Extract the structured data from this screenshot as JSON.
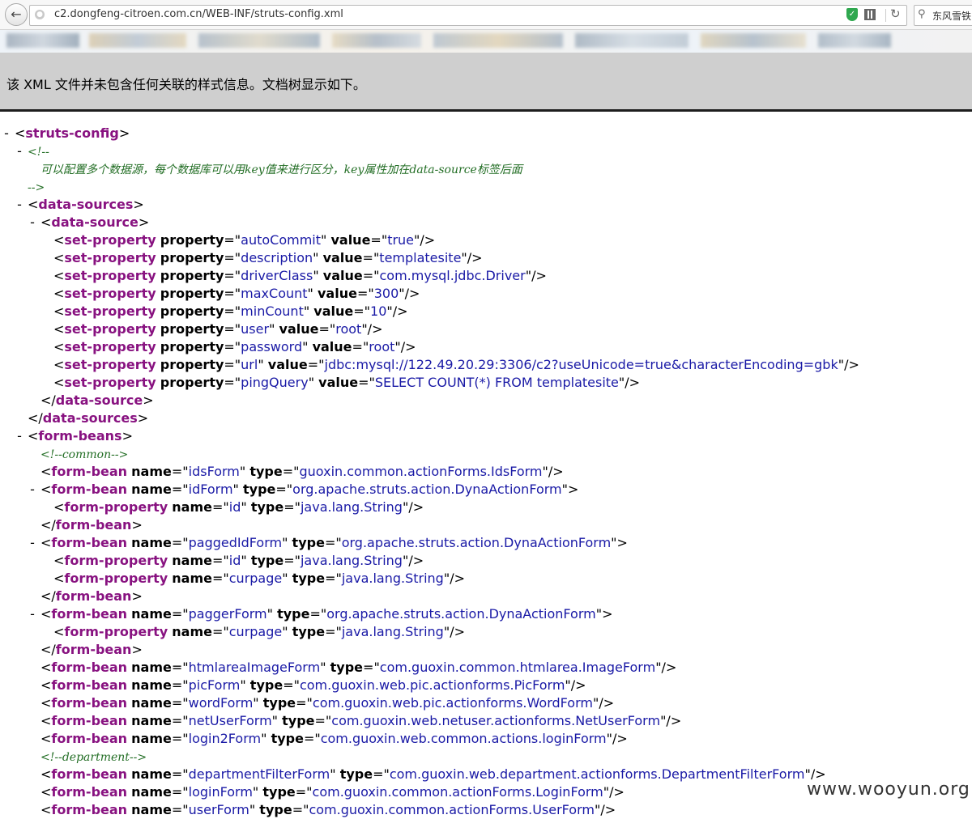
{
  "browser": {
    "url": "c2.dongfeng-citroen.com.cn/WEB-INF/struts-config.xml",
    "search_text": "东风雪铁",
    "icons": [
      "back-icon",
      "globe-icon",
      "shield-icon",
      "qr-icon",
      "refresh-icon",
      "search-icon"
    ]
  },
  "info_message": "该 XML 文件并未包含任何关联的样式信息。文档树显示如下。",
  "xml_lines": [
    {
      "indent": 0,
      "toggle": "-",
      "kind": "open",
      "tag": "struts-config"
    },
    {
      "indent": 1,
      "toggle": "-",
      "kind": "comment",
      "text": "<!--"
    },
    {
      "indent": 2,
      "toggle": "",
      "kind": "comment",
      "text": "可以配置多个数据源，每个数据库可以用key值来进行区分，key属性加在data-source标签后面"
    },
    {
      "indent": 1,
      "toggle": "",
      "kind": "comment",
      "text": "-->"
    },
    {
      "indent": 1,
      "toggle": "-",
      "kind": "open",
      "tag": "data-sources"
    },
    {
      "indent": 2,
      "toggle": "-",
      "kind": "open",
      "tag": "data-source"
    },
    {
      "indent": 3,
      "toggle": "",
      "kind": "self",
      "tag": "set-property",
      "attrs": [
        [
          "property",
          "autoCommit"
        ],
        [
          "value",
          "true"
        ]
      ]
    },
    {
      "indent": 3,
      "toggle": "",
      "kind": "self",
      "tag": "set-property",
      "attrs": [
        [
          "property",
          "description"
        ],
        [
          "value",
          "templatesite"
        ]
      ]
    },
    {
      "indent": 3,
      "toggle": "",
      "kind": "self",
      "tag": "set-property",
      "attrs": [
        [
          "property",
          "driverClass"
        ],
        [
          "value",
          "com.mysql.jdbc.Driver"
        ]
      ]
    },
    {
      "indent": 3,
      "toggle": "",
      "kind": "self",
      "tag": "set-property",
      "attrs": [
        [
          "property",
          "maxCount"
        ],
        [
          "value",
          "300"
        ]
      ]
    },
    {
      "indent": 3,
      "toggle": "",
      "kind": "self",
      "tag": "set-property",
      "attrs": [
        [
          "property",
          "minCount"
        ],
        [
          "value",
          "10"
        ]
      ]
    },
    {
      "indent": 3,
      "toggle": "",
      "kind": "self",
      "tag": "set-property",
      "attrs": [
        [
          "property",
          "user"
        ],
        [
          "value",
          "root"
        ]
      ]
    },
    {
      "indent": 3,
      "toggle": "",
      "kind": "self",
      "tag": "set-property",
      "attrs": [
        [
          "property",
          "password"
        ],
        [
          "value",
          "root"
        ]
      ]
    },
    {
      "indent": 3,
      "toggle": "",
      "kind": "self",
      "tag": "set-property",
      "attrs": [
        [
          "property",
          "url"
        ],
        [
          "value",
          "jdbc:mysql://122.49.20.29:3306/c2?useUnicode=true&characterEncoding=gbk"
        ]
      ]
    },
    {
      "indent": 3,
      "toggle": "",
      "kind": "self",
      "tag": "set-property",
      "attrs": [
        [
          "property",
          "pingQuery"
        ],
        [
          "value",
          "SELECT COUNT(*) FROM templatesite"
        ]
      ]
    },
    {
      "indent": 2,
      "toggle": "",
      "kind": "close",
      "tag": "data-source"
    },
    {
      "indent": 1,
      "toggle": "",
      "kind": "close",
      "tag": "data-sources"
    },
    {
      "indent": 1,
      "toggle": "-",
      "kind": "open",
      "tag": "form-beans"
    },
    {
      "indent": 2,
      "toggle": "",
      "kind": "comment",
      "text": "<!--common-->"
    },
    {
      "indent": 2,
      "toggle": "",
      "kind": "self",
      "tag": "form-bean",
      "attrs": [
        [
          "name",
          "idsForm"
        ],
        [
          "type",
          "guoxin.common.actionForms.IdsForm"
        ]
      ]
    },
    {
      "indent": 2,
      "toggle": "-",
      "kind": "open",
      "tag": "form-bean",
      "attrs": [
        [
          "name",
          "idForm"
        ],
        [
          "type",
          "org.apache.struts.action.DynaActionForm"
        ]
      ]
    },
    {
      "indent": 3,
      "toggle": "",
      "kind": "self",
      "tag": "form-property",
      "attrs": [
        [
          "name",
          "id"
        ],
        [
          "type",
          "java.lang.String"
        ]
      ]
    },
    {
      "indent": 2,
      "toggle": "",
      "kind": "close",
      "tag": "form-bean"
    },
    {
      "indent": 2,
      "toggle": "-",
      "kind": "open",
      "tag": "form-bean",
      "attrs": [
        [
          "name",
          "paggedIdForm"
        ],
        [
          "type",
          "org.apache.struts.action.DynaActionForm"
        ]
      ]
    },
    {
      "indent": 3,
      "toggle": "",
      "kind": "self",
      "tag": "form-property",
      "attrs": [
        [
          "name",
          "id"
        ],
        [
          "type",
          "java.lang.String"
        ]
      ]
    },
    {
      "indent": 3,
      "toggle": "",
      "kind": "self",
      "tag": "form-property",
      "attrs": [
        [
          "name",
          "curpage"
        ],
        [
          "type",
          "java.lang.String"
        ]
      ]
    },
    {
      "indent": 2,
      "toggle": "",
      "kind": "close",
      "tag": "form-bean"
    },
    {
      "indent": 2,
      "toggle": "-",
      "kind": "open",
      "tag": "form-bean",
      "attrs": [
        [
          "name",
          "paggerForm"
        ],
        [
          "type",
          "org.apache.struts.action.DynaActionForm"
        ]
      ]
    },
    {
      "indent": 3,
      "toggle": "",
      "kind": "self",
      "tag": "form-property",
      "attrs": [
        [
          "name",
          "curpage"
        ],
        [
          "type",
          "java.lang.String"
        ]
      ]
    },
    {
      "indent": 2,
      "toggle": "",
      "kind": "close",
      "tag": "form-bean"
    },
    {
      "indent": 2,
      "toggle": "",
      "kind": "self",
      "tag": "form-bean",
      "attrs": [
        [
          "name",
          "htmlareaImageForm"
        ],
        [
          "type",
          "com.guoxin.common.htmlarea.ImageForm"
        ]
      ]
    },
    {
      "indent": 2,
      "toggle": "",
      "kind": "self",
      "tag": "form-bean",
      "attrs": [
        [
          "name",
          "picForm"
        ],
        [
          "type",
          "com.guoxin.web.pic.actionforms.PicForm"
        ]
      ]
    },
    {
      "indent": 2,
      "toggle": "",
      "kind": "self",
      "tag": "form-bean",
      "attrs": [
        [
          "name",
          "wordForm"
        ],
        [
          "type",
          "com.guoxin.web.pic.actionforms.WordForm"
        ]
      ]
    },
    {
      "indent": 2,
      "toggle": "",
      "kind": "self",
      "tag": "form-bean",
      "attrs": [
        [
          "name",
          "netUserForm"
        ],
        [
          "type",
          "com.guoxin.web.netuser.actionforms.NetUserForm"
        ]
      ]
    },
    {
      "indent": 2,
      "toggle": "",
      "kind": "self",
      "tag": "form-bean",
      "attrs": [
        [
          "name",
          "login2Form"
        ],
        [
          "type",
          "com.guoxin.web.common.actions.loginForm"
        ]
      ]
    },
    {
      "indent": 2,
      "toggle": "",
      "kind": "comment",
      "text": "<!--department-->"
    },
    {
      "indent": 2,
      "toggle": "",
      "kind": "self",
      "tag": "form-bean",
      "attrs": [
        [
          "name",
          "departmentFilterForm"
        ],
        [
          "type",
          "com.guoxin.web.department.actionforms.DepartmentFilterForm"
        ]
      ]
    },
    {
      "indent": 2,
      "toggle": "",
      "kind": "self",
      "tag": "form-bean",
      "attrs": [
        [
          "name",
          "loginForm"
        ],
        [
          "type",
          "com.guoxin.common.actionForms.LoginForm"
        ]
      ]
    },
    {
      "indent": 2,
      "toggle": "",
      "kind": "self",
      "tag": "form-bean",
      "attrs": [
        [
          "name",
          "userForm"
        ],
        [
          "type",
          "com.guoxin.common.actionForms.UserForm"
        ]
      ]
    }
  ],
  "watermark": "www.wooyun.org",
  "colors": {
    "tag": "#881280",
    "attr_value": "#1a1aa6",
    "comment": "#236e25",
    "infobar": "#cfcfcf"
  }
}
